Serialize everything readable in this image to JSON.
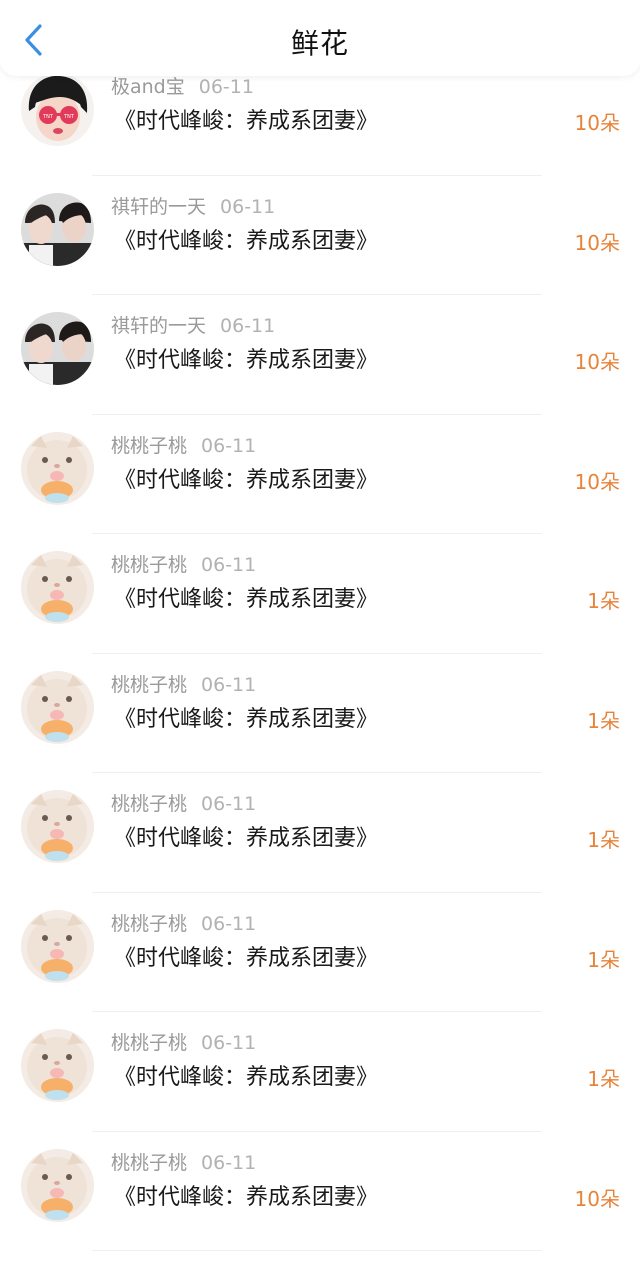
{
  "header": {
    "title": "鲜花",
    "back_icon": "chevron-left-icon",
    "accent_color": "#3a8ee6"
  },
  "amount_color": "#e8833a",
  "rows": [
    {
      "user": "极and宝",
      "date": "06-11",
      "book": "《时代峰峻：养成系团妻》",
      "amount": "10朵",
      "avatar": "girl-sunglasses-avatar"
    },
    {
      "user": "祺轩的一天",
      "date": "06-11",
      "book": "《时代峰峻：养成系团妻》",
      "amount": "10朵",
      "avatar": "two-boys-avatar"
    },
    {
      "user": "祺轩的一天",
      "date": "06-11",
      "book": "《时代峰峻：养成系团妻》",
      "amount": "10朵",
      "avatar": "two-boys-avatar"
    },
    {
      "user": "桃桃子桃",
      "date": "06-11",
      "book": "《时代峰峻：养成系团妻》",
      "amount": "10朵",
      "avatar": "cat-avatar"
    },
    {
      "user": "桃桃子桃",
      "date": "06-11",
      "book": "《时代峰峻：养成系团妻》",
      "amount": "1朵",
      "avatar": "cat-avatar"
    },
    {
      "user": "桃桃子桃",
      "date": "06-11",
      "book": "《时代峰峻：养成系团妻》",
      "amount": "1朵",
      "avatar": "cat-avatar"
    },
    {
      "user": "桃桃子桃",
      "date": "06-11",
      "book": "《时代峰峻：养成系团妻》",
      "amount": "1朵",
      "avatar": "cat-avatar"
    },
    {
      "user": "桃桃子桃",
      "date": "06-11",
      "book": "《时代峰峻：养成系团妻》",
      "amount": "1朵",
      "avatar": "cat-avatar"
    },
    {
      "user": "桃桃子桃",
      "date": "06-11",
      "book": "《时代峰峻：养成系团妻》",
      "amount": "1朵",
      "avatar": "cat-avatar"
    },
    {
      "user": "桃桃子桃",
      "date": "06-11",
      "book": "《时代峰峻：养成系团妻》",
      "amount": "10朵",
      "avatar": "cat-avatar"
    }
  ]
}
